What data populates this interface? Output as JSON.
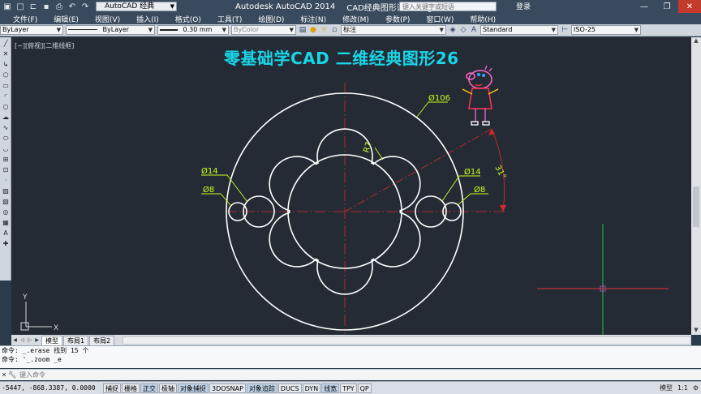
{
  "window": {
    "app_title": "Autodesk AutoCAD 2014",
    "doc_title": "CAD经典图形课程.dwg",
    "workspace": "AutoCAD 经典",
    "search_placeholder": "键入关键字或短语",
    "login_label": "登录",
    "minimize_label": "—",
    "restore_label": "❐",
    "close_label": "✕"
  },
  "menu": [
    "文件(F)",
    "编辑(E)",
    "视图(V)",
    "插入(I)",
    "格式(O)",
    "工具(T)",
    "绘图(D)",
    "标注(N)",
    "修改(M)",
    "参数(P)",
    "窗口(W)",
    "帮助(H)"
  ],
  "properties": {
    "color": "ByLayer",
    "linetype": "ByLayer",
    "lineweight": "0.30 mm",
    "plotstyle": "ByColor",
    "layer": "标注",
    "text_style": "Standard",
    "dim_style": "ISO-25"
  },
  "canvas": {
    "viewport_label": "[−][俯视][二维线框]",
    "banner": "零基础学CAD  二维经典图形26",
    "colors": {
      "background": "#252b35",
      "geometry": "#ffffff",
      "centerline": "#d42a2a",
      "dimension": "#c8ff1e",
      "banner": "#18d6e8",
      "ucs": "#d8d8d8",
      "cursor_vertical": "#1fd44a",
      "cursor_horizontal": "#e43030",
      "cursor_pickbox": "#c040c0"
    },
    "dimensions": {
      "outer": "Ø106",
      "radius": "R7",
      "angle": "31°",
      "left_large": "Ø14",
      "left_small": "Ø8",
      "right_large": "Ø14",
      "right_small": "Ø8"
    },
    "ucs": {
      "x_label": "X",
      "y_label": "Y"
    }
  },
  "tabs": [
    "模型",
    "布局1",
    "布局2"
  ],
  "command_history": [
    "命令: _.erase 找到 15 个",
    "命令: '_.zoom _e"
  ],
  "command_placeholder": "键入命令",
  "status": {
    "coords": "-5447, -868.3387, 0.0000",
    "buttons": [
      {
        "label": "捕捉",
        "on": false
      },
      {
        "label": "栅格",
        "on": false
      },
      {
        "label": "正交",
        "on": true
      },
      {
        "label": "极轴",
        "on": false
      },
      {
        "label": "对象捕捉",
        "on": true
      },
      {
        "label": "3DOSNAP",
        "on": false
      },
      {
        "label": "对象追踪",
        "on": true
      },
      {
        "label": "DUCS",
        "on": false
      },
      {
        "label": "DYN",
        "on": false
      },
      {
        "label": "线宽",
        "on": true
      },
      {
        "label": "TPY",
        "on": false
      },
      {
        "label": "QP",
        "on": false
      }
    ],
    "right": [
      "模型",
      "1:1",
      "⚙"
    ]
  }
}
